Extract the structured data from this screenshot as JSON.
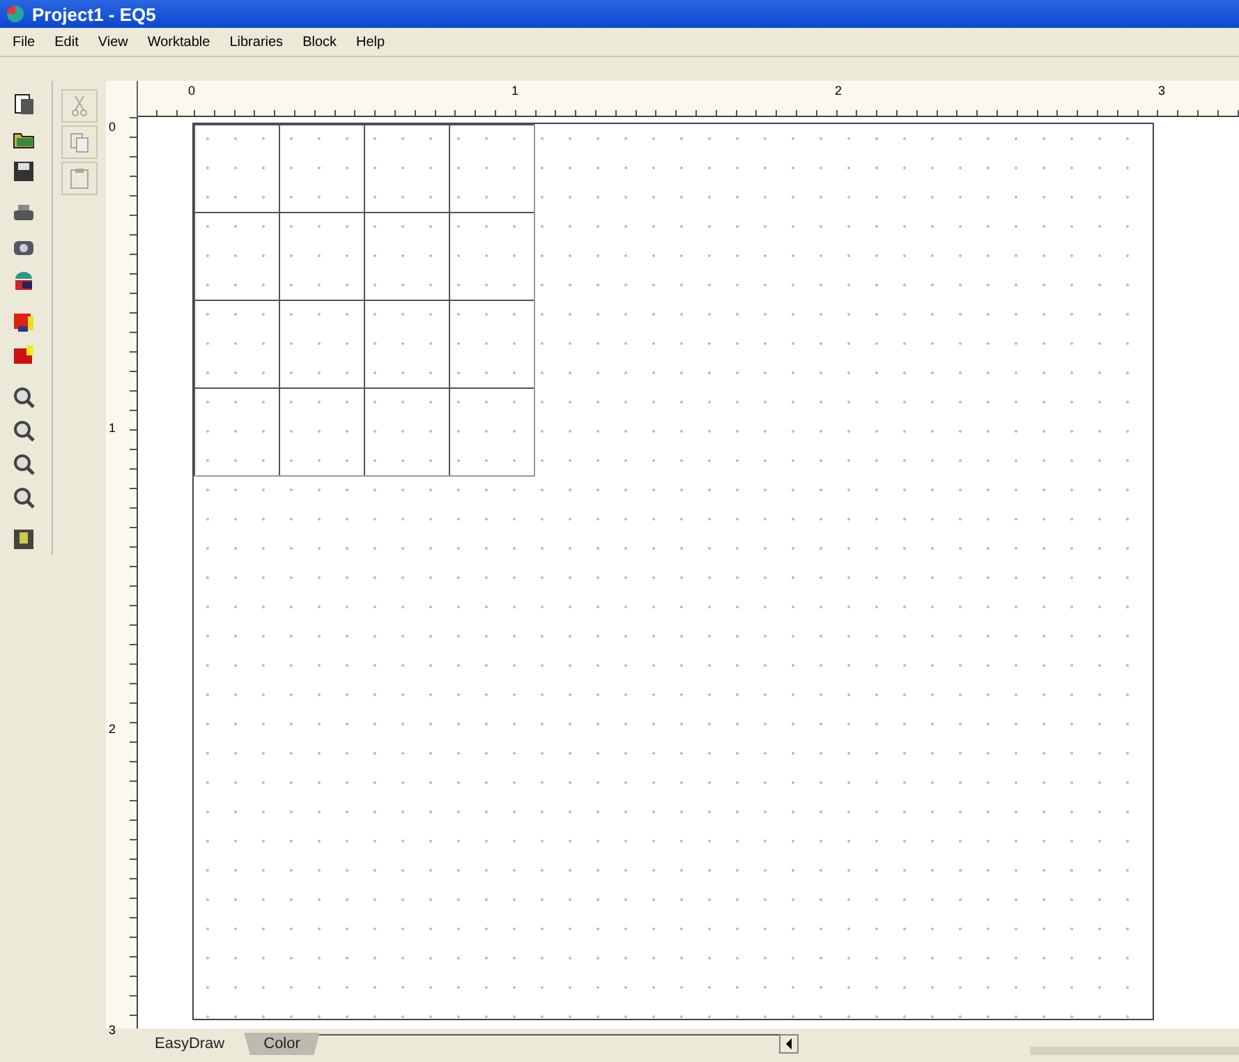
{
  "window": {
    "title": "Project1 - EQ5"
  },
  "menu": [
    "File",
    "Edit",
    "View",
    "Worktable",
    "Libraries",
    "Block",
    "Help"
  ],
  "toolbar": [
    {
      "kind": "new"
    },
    {
      "kind": "open"
    },
    {
      "kind": "save"
    },
    {
      "kind": "print"
    },
    {
      "kind": "camera"
    },
    {
      "kind": "library"
    },
    {
      "kind": "block"
    },
    {
      "kind": "block2"
    },
    {
      "kind": "zoom"
    },
    {
      "kind": "zoom"
    },
    {
      "kind": "zoom"
    },
    {
      "kind": "zoom"
    },
    {
      "kind": "film"
    }
  ],
  "edit_toolbar": [
    {
      "kind": "cut",
      "disabled": true
    },
    {
      "kind": "copy",
      "disabled": true
    },
    {
      "kind": "paste",
      "disabled": true
    }
  ],
  "ruler_h": [
    "0",
    "1",
    "2",
    "3"
  ],
  "ruler_v": [
    "0",
    "1",
    "2",
    "3"
  ],
  "tabs": [
    {
      "label": "EasyDraw",
      "selected": true
    },
    {
      "label": "Color",
      "selected": false
    }
  ]
}
